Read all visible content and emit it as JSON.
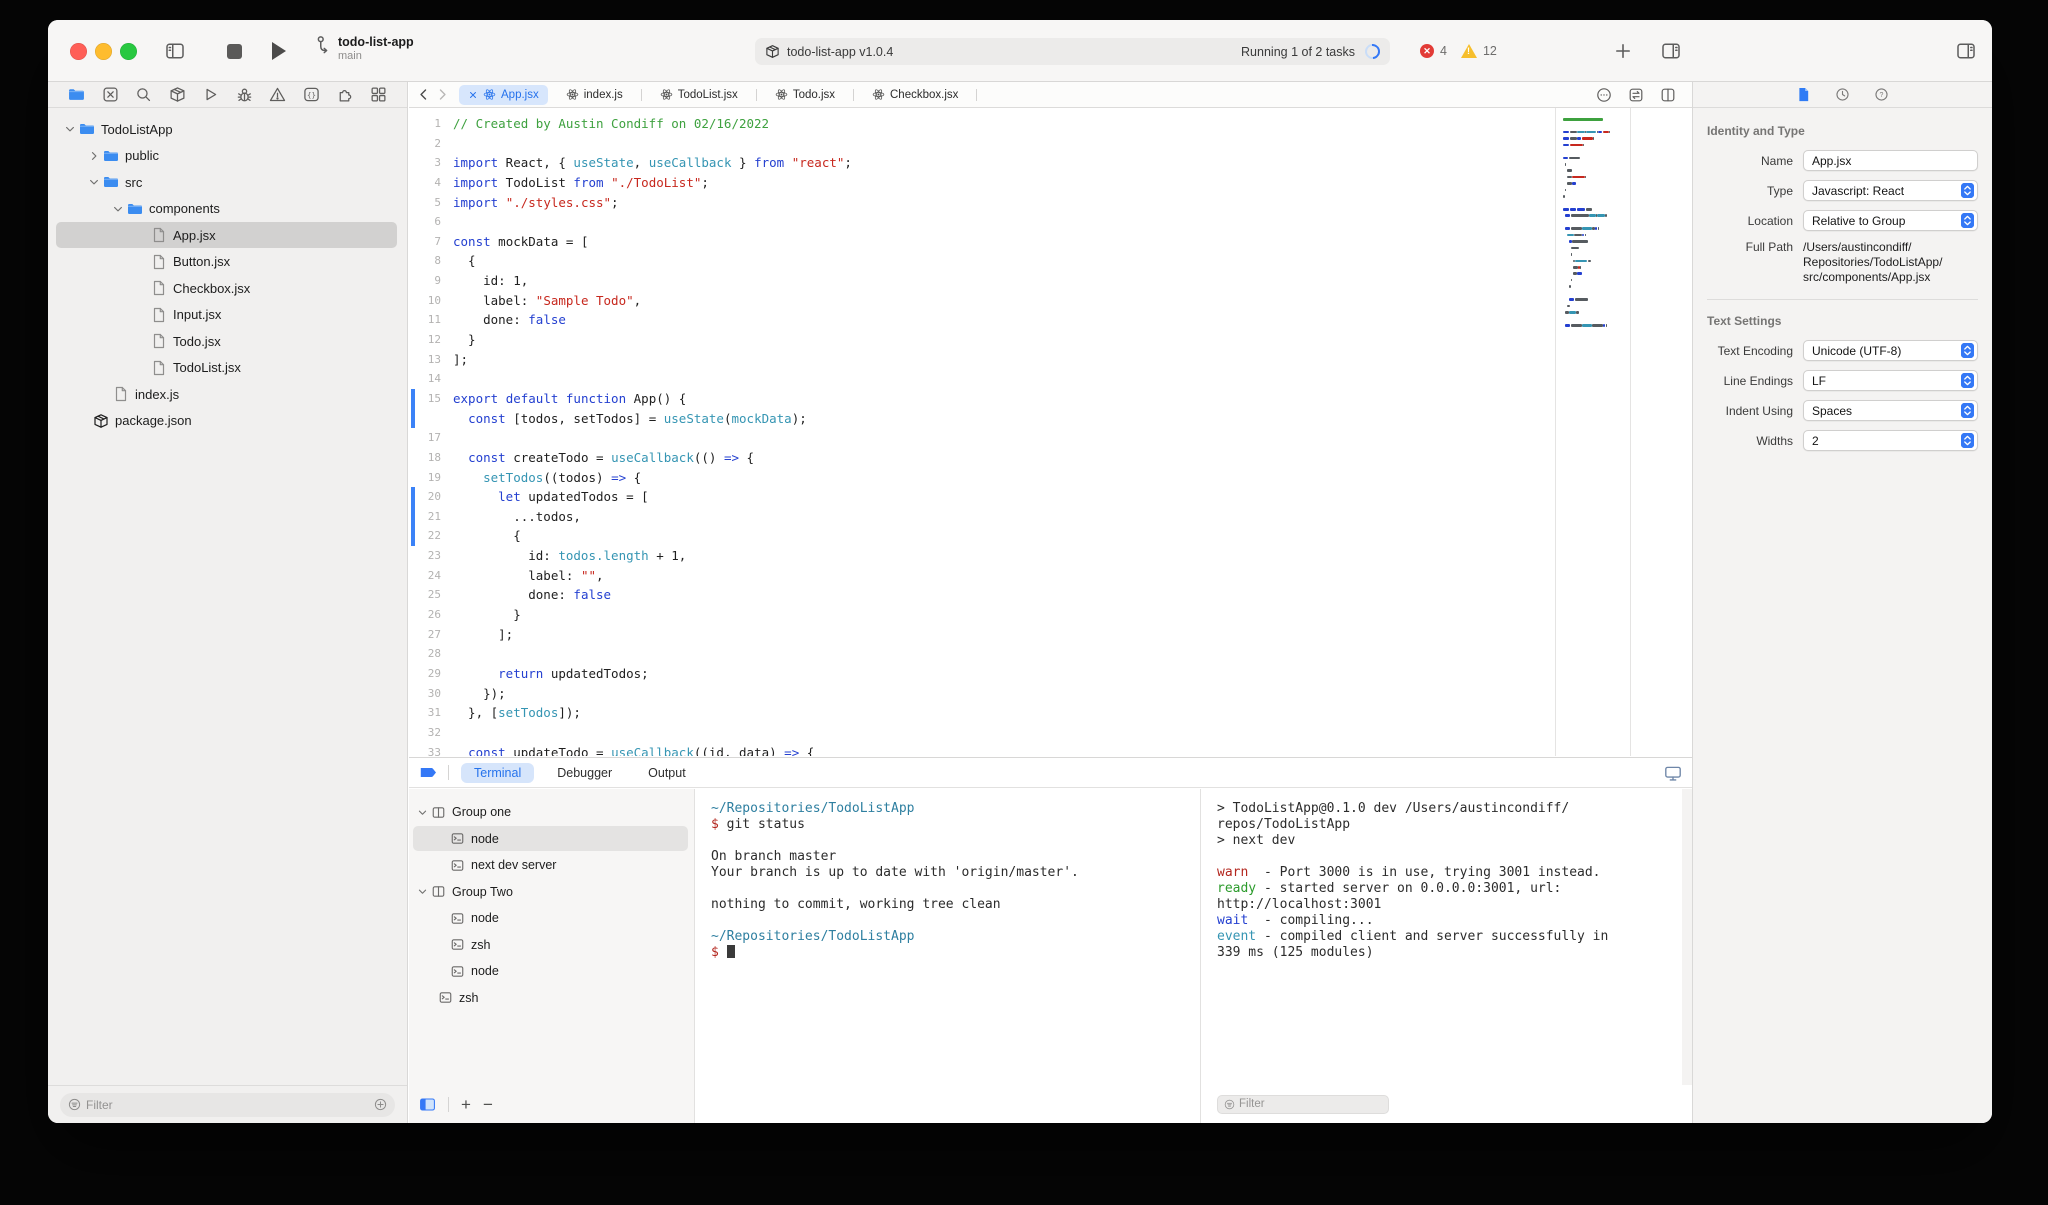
{
  "chrome": {
    "project": "todo-list-app",
    "branch": "main",
    "package_title": "todo-list-app v1.0.4",
    "tasks_status": "Running 1 of 2 tasks",
    "error_count": "4",
    "warning_count": "12",
    "accent_color": "#3478f6",
    "traffic_lights": [
      "close",
      "minimize",
      "zoom"
    ]
  },
  "navigator": {
    "toolbar_icons": [
      "folder",
      "source-control",
      "search",
      "package",
      "play",
      "bug",
      "warning",
      "braces",
      "puzzle",
      "grid"
    ],
    "active_toolbar_icon": "folder",
    "tree": [
      {
        "label": "TodoListApp",
        "icon": "folder",
        "chevron": "down",
        "indent": 16
      },
      {
        "label": "public",
        "icon": "folder",
        "chevron": "right",
        "indent": 40
      },
      {
        "label": "src",
        "icon": "folder",
        "chevron": "down",
        "indent": 40
      },
      {
        "label": "components",
        "icon": "folder",
        "chevron": "down",
        "indent": 64
      },
      {
        "label": "App.jsx",
        "icon": "file",
        "indent": 100,
        "selected": true
      },
      {
        "label": "Button.jsx",
        "icon": "file",
        "indent": 100
      },
      {
        "label": "Checkbox.jsx",
        "icon": "file",
        "indent": 100
      },
      {
        "label": "Input.jsx",
        "icon": "file",
        "indent": 100
      },
      {
        "label": "Todo.jsx",
        "icon": "file",
        "indent": 100
      },
      {
        "label": "TodoList.jsx",
        "icon": "file",
        "indent": 100
      },
      {
        "label": "index.js",
        "icon": "file",
        "indent": 62
      },
      {
        "label": "package.json",
        "icon": "package",
        "indent": 42
      }
    ],
    "filter": {
      "placeholder": "Filter"
    }
  },
  "editor": {
    "tabs": [
      {
        "label": "App.jsx",
        "active": true
      },
      {
        "label": "index.js"
      },
      {
        "label": "TodoList.jsx"
      },
      {
        "label": "Todo.jsx"
      },
      {
        "label": "Checkbox.jsx"
      }
    ],
    "code": [
      {
        "n": "1",
        "tokens": [
          [
            "c",
            "// Created by Austin Condiff on 02/16/2022"
          ]
        ]
      },
      {
        "n": "2",
        "tokens": []
      },
      {
        "n": "3",
        "tokens": [
          [
            "k",
            "import"
          ],
          [
            "p",
            " React, { "
          ],
          [
            "f",
            "useState"
          ],
          [
            "p",
            ", "
          ],
          [
            "f",
            "useCallback"
          ],
          [
            "p",
            " } "
          ],
          [
            "k",
            "from"
          ],
          [
            "p",
            " "
          ],
          [
            "s",
            "\"react\""
          ],
          [
            "p",
            ";"
          ]
        ]
      },
      {
        "n": "4",
        "tokens": [
          [
            "k",
            "import"
          ],
          [
            "p",
            " TodoList "
          ],
          [
            "k",
            "from"
          ],
          [
            "p",
            " "
          ],
          [
            "s",
            "\"./TodoList\""
          ],
          [
            "p",
            ";"
          ]
        ]
      },
      {
        "n": "5",
        "tokens": [
          [
            "k",
            "import"
          ],
          [
            "p",
            " "
          ],
          [
            "s",
            "\"./styles.css\""
          ],
          [
            "p",
            ";"
          ]
        ]
      },
      {
        "n": "6",
        "tokens": []
      },
      {
        "n": "7",
        "tokens": [
          [
            "k",
            "const"
          ],
          [
            "p",
            " mockData = ["
          ]
        ]
      },
      {
        "n": "8",
        "tokens": [
          [
            "p",
            "  {"
          ]
        ]
      },
      {
        "n": "9",
        "tokens": [
          [
            "p",
            "    id: 1,"
          ]
        ]
      },
      {
        "n": "10",
        "tokens": [
          [
            "p",
            "    label: "
          ],
          [
            "s",
            "\"Sample Todo\""
          ],
          [
            "p",
            ","
          ]
        ]
      },
      {
        "n": "11",
        "tokens": [
          [
            "p",
            "    done: "
          ],
          [
            "k",
            "false"
          ]
        ]
      },
      {
        "n": "12",
        "tokens": [
          [
            "p",
            "  }"
          ]
        ]
      },
      {
        "n": "13",
        "tokens": [
          [
            "p",
            "];"
          ]
        ]
      },
      {
        "n": "14",
        "tokens": []
      },
      {
        "n": "15",
        "tokens": [
          [
            "k",
            "export"
          ],
          [
            "p",
            " "
          ],
          [
            "k",
            "default"
          ],
          [
            "p",
            " "
          ],
          [
            "k",
            "function"
          ],
          [
            "p",
            " App() {"
          ]
        ],
        "changed": true
      },
      {
        "n": "",
        "tokens": [
          [
            "p",
            "  "
          ],
          [
            "k",
            "const"
          ],
          [
            "p",
            " [todos, setTodos] = "
          ],
          [
            "f",
            "useState"
          ],
          [
            "p",
            "("
          ],
          [
            "f",
            "mockData"
          ],
          [
            "p",
            ");"
          ]
        ],
        "changed": true
      },
      {
        "n": "17",
        "tokens": []
      },
      {
        "n": "18",
        "tokens": [
          [
            "p",
            "  "
          ],
          [
            "k",
            "const"
          ],
          [
            "p",
            " createTodo = "
          ],
          [
            "f",
            "useCallback"
          ],
          [
            "p",
            "(() "
          ],
          [
            "k",
            "=>"
          ],
          [
            "p",
            " {"
          ]
        ]
      },
      {
        "n": "19",
        "tokens": [
          [
            "p",
            "    "
          ],
          [
            "f",
            "setTodos"
          ],
          [
            "p",
            "((todos) "
          ],
          [
            "k",
            "=>"
          ],
          [
            "p",
            " {"
          ]
        ]
      },
      {
        "n": "20",
        "tokens": [
          [
            "p",
            "      "
          ],
          [
            "k",
            "let"
          ],
          [
            "p",
            " updatedTodos = ["
          ]
        ],
        "changed": true
      },
      {
        "n": "21",
        "tokens": [
          [
            "p",
            "        ...todos,"
          ]
        ],
        "changed": true
      },
      {
        "n": "22",
        "tokens": [
          [
            "p",
            "        {"
          ]
        ],
        "changed": true
      },
      {
        "n": "23",
        "tokens": [
          [
            "p",
            "          id: "
          ],
          [
            "f",
            "todos.length"
          ],
          [
            "p",
            " + 1,"
          ]
        ]
      },
      {
        "n": "24",
        "tokens": [
          [
            "p",
            "          label: "
          ],
          [
            "s",
            "\"\""
          ],
          [
            "p",
            ","
          ]
        ]
      },
      {
        "n": "25",
        "tokens": [
          [
            "p",
            "          done: "
          ],
          [
            "k",
            "false"
          ]
        ]
      },
      {
        "n": "26",
        "tokens": [
          [
            "p",
            "        }"
          ]
        ]
      },
      {
        "n": "27",
        "tokens": [
          [
            "p",
            "      ];"
          ]
        ]
      },
      {
        "n": "28",
        "tokens": []
      },
      {
        "n": "29",
        "tokens": [
          [
            "p",
            "      "
          ],
          [
            "k",
            "return"
          ],
          [
            "p",
            " updatedTodos;"
          ]
        ]
      },
      {
        "n": "30",
        "tokens": [
          [
            "p",
            "    });"
          ]
        ]
      },
      {
        "n": "31",
        "tokens": [
          [
            "p",
            "  }, ["
          ],
          [
            "f",
            "setTodos"
          ],
          [
            "p",
            "]);"
          ]
        ]
      },
      {
        "n": "32",
        "tokens": []
      },
      {
        "n": "33",
        "tokens": [
          [
            "p",
            "  "
          ],
          [
            "k",
            "const"
          ],
          [
            "p",
            " updateTodo = "
          ],
          [
            "f",
            "useCallback"
          ],
          [
            "p",
            "((id, data) "
          ],
          [
            "k",
            "=>"
          ],
          [
            "p",
            " {"
          ]
        ]
      }
    ]
  },
  "inspector": {
    "header_icons": [
      "file-blue",
      "clock",
      "help"
    ],
    "sections": [
      {
        "title": "Identity and Type",
        "rows": [
          {
            "label": "Name",
            "value": "App.jsx",
            "control": "input"
          },
          {
            "label": "Type",
            "value": "Javascript: React",
            "control": "select"
          },
          {
            "label": "Location",
            "value": "Relative to Group",
            "control": "select"
          },
          {
            "label": "Full Path",
            "value": [
              "/Users/austincondiff/",
              "Repositories/TodoListApp/",
              "src/components/App.jsx"
            ],
            "control": "static"
          }
        ]
      },
      {
        "title": "Text Settings",
        "rows": [
          {
            "label": "Text Encoding",
            "value": "Unicode (UTF-8)",
            "control": "select"
          },
          {
            "label": "Line Endings",
            "value": "LF",
            "control": "select"
          },
          {
            "label": "Indent Using",
            "value": "Spaces",
            "control": "select"
          },
          {
            "label": "Widths",
            "value": "2",
            "control": "select"
          }
        ]
      }
    ]
  },
  "panel": {
    "tabs": [
      {
        "label": "Terminal",
        "active": true
      },
      {
        "label": "Debugger"
      },
      {
        "label": "Output"
      }
    ],
    "sidebar": [
      {
        "label": "Group one",
        "icon": "term-group",
        "chevron": "down",
        "indent": 8
      },
      {
        "label": "node",
        "icon": "term",
        "indent": 38,
        "selected": true
      },
      {
        "label": "next dev server",
        "icon": "term",
        "indent": 38
      },
      {
        "label": "Group Two",
        "icon": "term-group",
        "chevron": "down",
        "indent": 8
      },
      {
        "label": "node",
        "icon": "term",
        "indent": 38
      },
      {
        "label": "zsh",
        "icon": "term",
        "indent": 38
      },
      {
        "label": "node",
        "icon": "term",
        "indent": 38
      },
      {
        "label": "zsh",
        "icon": "term",
        "indent": 26
      }
    ],
    "terminal_git": [
      [
        [
          "path",
          "~/Repositories/TodoListApp"
        ]
      ],
      [
        [
          "prompt",
          "$ "
        ],
        [
          "plain",
          "git status"
        ]
      ],
      [],
      [
        [
          "plain",
          "On branch master"
        ]
      ],
      [
        [
          "plain",
          "Your branch is up to date with 'origin/master'."
        ]
      ],
      [],
      [
        [
          "plain",
          "nothing to commit, working tree clean"
        ]
      ],
      [],
      [
        [
          "path",
          "~/Repositories/TodoListApp"
        ]
      ],
      [
        [
          "prompt",
          "$ "
        ],
        [
          "cursor",
          ""
        ]
      ]
    ],
    "terminal_dev": [
      [
        [
          "plain",
          "> TodoListApp@0.1.0 dev /Users/austincondiff/"
        ]
      ],
      [
        [
          "plain",
          "repos/TodoListApp"
        ]
      ],
      [
        [
          "plain",
          "> next dev"
        ]
      ],
      [],
      [
        [
          "warn",
          "warn"
        ],
        [
          "plain",
          "  - Port 3000 is in use, trying 3001 instead."
        ]
      ],
      [
        [
          "ready",
          "ready"
        ],
        [
          "plain",
          " - started server on 0.0.0.0:3001, url:"
        ]
      ],
      [
        [
          "plain",
          "http://localhost:3001"
        ]
      ],
      [
        [
          "wait",
          "wait"
        ],
        [
          "plain",
          "  - compiling..."
        ]
      ],
      [
        [
          "event",
          "event"
        ],
        [
          "plain",
          " - compiled client and server successfully in"
        ]
      ],
      [
        [
          "plain",
          "339 ms (125 modules)"
        ]
      ]
    ],
    "filter": {
      "placeholder": "Filter"
    }
  }
}
